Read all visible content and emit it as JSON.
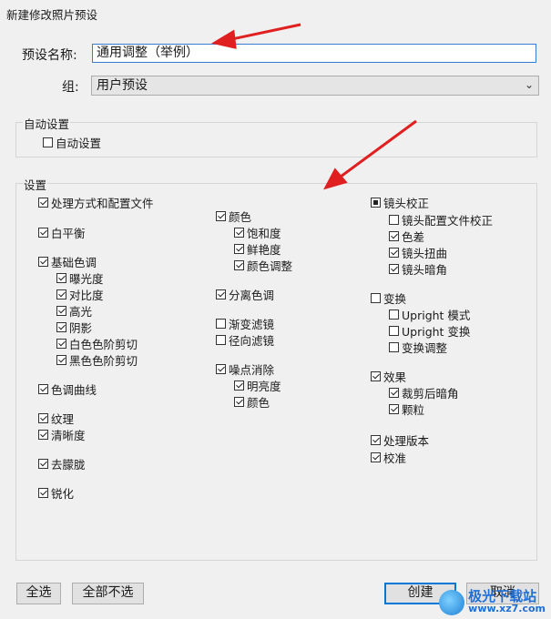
{
  "dialog": {
    "title": "新建修改照片预设"
  },
  "preset": {
    "name_label": "预设名称:",
    "name_value": "通用调整（举例）",
    "group_label": "组:",
    "group_value": "用户预设"
  },
  "auto": {
    "group_title": "自动设置",
    "checkbox_label": "自动设置",
    "checked": false
  },
  "settings": {
    "group_title": "设置",
    "col1": [
      {
        "label": "处理方式和配置文件",
        "state": "checked"
      },
      {
        "label": "白平衡",
        "state": "checked"
      },
      {
        "label": "基础色调",
        "state": "checked"
      },
      {
        "label": "曝光度",
        "state": "checked"
      },
      {
        "label": "对比度",
        "state": "checked"
      },
      {
        "label": "高光",
        "state": "checked"
      },
      {
        "label": "阴影",
        "state": "checked"
      },
      {
        "label": "白色色阶剪切",
        "state": "checked"
      },
      {
        "label": "黑色色阶剪切",
        "state": "checked"
      },
      {
        "label": "色调曲线",
        "state": "checked"
      },
      {
        "label": "纹理",
        "state": "checked"
      },
      {
        "label": "清晰度",
        "state": "checked"
      },
      {
        "label": "去朦胧",
        "state": "checked"
      },
      {
        "label": "锐化",
        "state": "checked"
      }
    ],
    "col2": [
      {
        "label": "颜色",
        "state": "checked"
      },
      {
        "label": "饱和度",
        "state": "checked"
      },
      {
        "label": "鲜艳度",
        "state": "checked"
      },
      {
        "label": "颜色调整",
        "state": "checked"
      },
      {
        "label": "分离色调",
        "state": "checked"
      },
      {
        "label": "渐变滤镜",
        "state": "unchecked"
      },
      {
        "label": "径向滤镜",
        "state": "unchecked"
      },
      {
        "label": "噪点消除",
        "state": "checked"
      },
      {
        "label": "明亮度",
        "state": "checked"
      },
      {
        "label": "颜色",
        "state": "checked"
      }
    ],
    "col3": [
      {
        "label": "镜头校正",
        "state": "indeterminate"
      },
      {
        "label": "镜头配置文件校正",
        "state": "unchecked"
      },
      {
        "label": "色差",
        "state": "checked"
      },
      {
        "label": "镜头扭曲",
        "state": "checked"
      },
      {
        "label": "镜头暗角",
        "state": "checked"
      },
      {
        "label": "变换",
        "state": "unchecked"
      },
      {
        "label": "Upright 模式",
        "state": "unchecked"
      },
      {
        "label": "Upright 变换",
        "state": "unchecked"
      },
      {
        "label": "变换调整",
        "state": "unchecked"
      },
      {
        "label": "效果",
        "state": "checked"
      },
      {
        "label": "裁剪后暗角",
        "state": "checked"
      },
      {
        "label": "颗粒",
        "state": "checked"
      },
      {
        "label": "处理版本",
        "state": "checked"
      },
      {
        "label": "校准",
        "state": "checked"
      }
    ]
  },
  "buttons": {
    "select_all": "全选",
    "select_none": "全部不选",
    "create": "创建",
    "cancel": "取消"
  },
  "watermark": {
    "line1": "极光下载站",
    "line2": "www.xz7.com"
  },
  "colors": {
    "annotation_arrow": "#e02020",
    "focus_border": "#0078d7"
  }
}
